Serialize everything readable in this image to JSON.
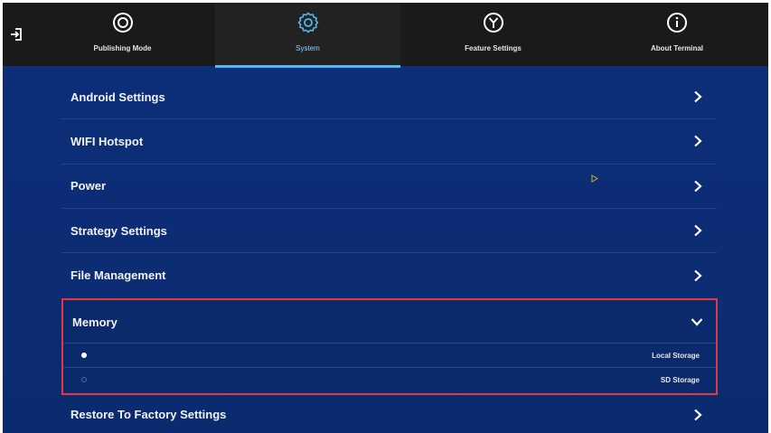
{
  "nav": {
    "tabs": [
      {
        "id": "publishing",
        "label": "Publishing Mode",
        "icon": "target-icon"
      },
      {
        "id": "system",
        "label": "System",
        "icon": "gear-icon",
        "active": true
      },
      {
        "id": "feature",
        "label": "Feature Settings",
        "icon": "y-circle-icon"
      },
      {
        "id": "about",
        "label": "About Terminal",
        "icon": "info-icon"
      }
    ]
  },
  "menu": {
    "items": [
      {
        "label": "Android Settings"
      },
      {
        "label": "WIFI Hotspot"
      },
      {
        "label": "Power"
      },
      {
        "label": "Strategy Settings"
      },
      {
        "label": "File Management"
      }
    ],
    "memory": {
      "label": "Memory",
      "options": [
        {
          "label": "Local Storage",
          "selected": true
        },
        {
          "label": "SD Storage",
          "selected": false
        }
      ]
    },
    "restore": {
      "label": "Restore To Factory Settings"
    }
  },
  "colors": {
    "background": "#0c2f78",
    "topbar": "#1a1a1a",
    "accent": "#56b8ef",
    "highlight_border": "#e4383e"
  }
}
